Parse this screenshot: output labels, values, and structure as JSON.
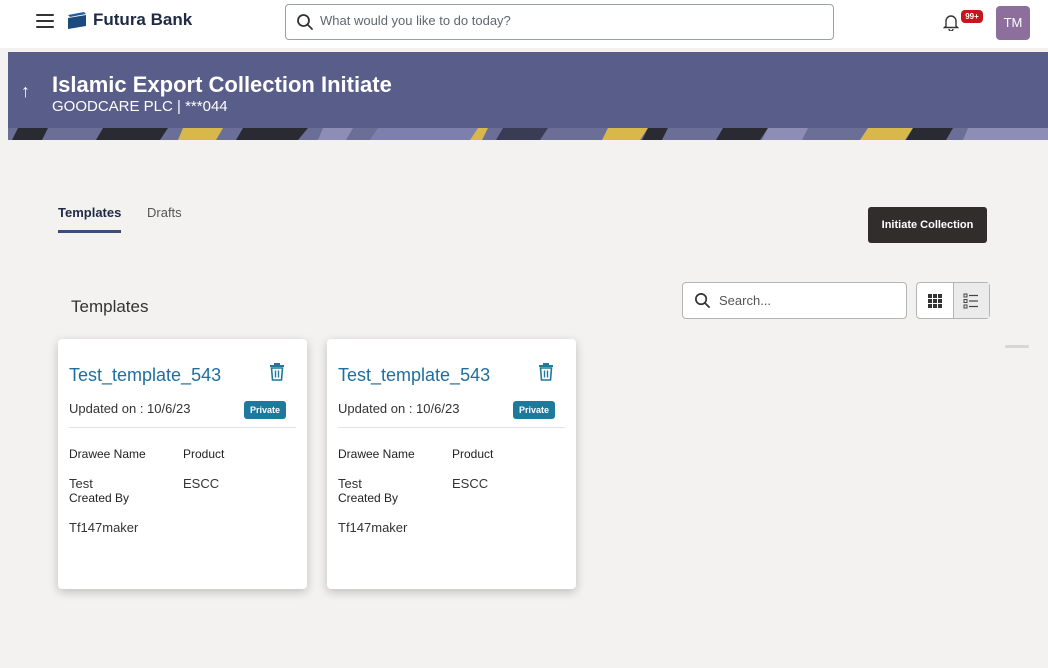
{
  "header": {
    "brand_name": "Futura Bank",
    "search_placeholder": "What would you like to do today?",
    "notification_count": "99+",
    "user_initials": "TM"
  },
  "banner": {
    "title": "Islamic Export Collection Initiate",
    "subtitle": "GOODCARE PLC | ***044"
  },
  "tabs": [
    {
      "label": "Templates",
      "active": true
    },
    {
      "label": "Drafts",
      "active": false
    }
  ],
  "actions": {
    "initiate_label": "Initiate Collection"
  },
  "section_title": "Templates",
  "list_search_placeholder": "Search...",
  "cards": [
    {
      "name": "Test_template_543",
      "updated": "Updated on : 10/6/23",
      "visibility": "Private",
      "drawee_label": "Drawee Name",
      "drawee_value": "Test",
      "product_label": "Product",
      "product_value": "ESCC",
      "created_by_label": "Created By",
      "created_by_value": "Tf147maker"
    },
    {
      "name": "Test_template_543",
      "updated": "Updated on : 10/6/23",
      "visibility": "Private",
      "drawee_label": "Drawee Name",
      "drawee_value": "Test",
      "product_label": "Product",
      "product_value": "ESCC",
      "created_by_label": "Created By",
      "created_by_value": "Tf147maker"
    }
  ],
  "colors": {
    "banner": "#595d8a",
    "link": "#1e6f9f",
    "badge": "#1e7a9c",
    "primary_button": "#312d2a",
    "notification": "#c7161b",
    "avatar": "#8d6f9d"
  },
  "icons": [
    "menu-icon",
    "bank-logo-icon",
    "search-icon",
    "bell-icon",
    "back-arrow-icon",
    "trash-icon",
    "grid-view-icon",
    "list-view-icon"
  ]
}
